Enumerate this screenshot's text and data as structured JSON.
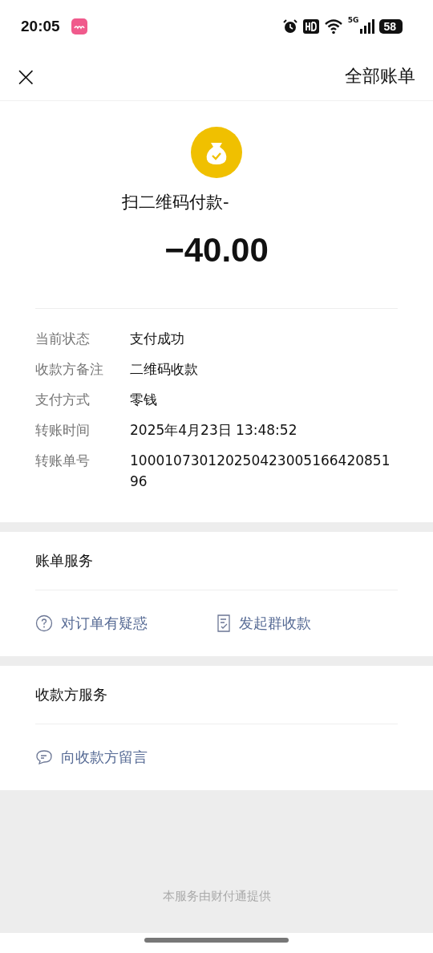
{
  "status_bar": {
    "time": "20:05",
    "battery": "58",
    "network": "5G"
  },
  "header": {
    "close": "×",
    "title": "全部账单"
  },
  "payment": {
    "title": "扫二维码付款-",
    "amount": "−40.00"
  },
  "details": [
    {
      "label": "当前状态",
      "value": "支付成功"
    },
    {
      "label": "收款方备注",
      "value": "二维码收款"
    },
    {
      "label": "支付方式",
      "value": "零钱"
    },
    {
      "label": "转账时间",
      "value": "2025年4月23日 13:48:52"
    },
    {
      "label": "转账单号",
      "value": "10001073012025042300516642085196"
    }
  ],
  "sections": [
    {
      "title": "账单服务",
      "actions": [
        {
          "kind": "question",
          "label": "对订单有疑惑"
        },
        {
          "kind": "receipt",
          "label": "发起群收款"
        }
      ]
    },
    {
      "title": "收款方服务",
      "actions": [
        {
          "kind": "message",
          "label": "向收款方留言"
        }
      ]
    }
  ],
  "footer": "本服务由财付通提供"
}
